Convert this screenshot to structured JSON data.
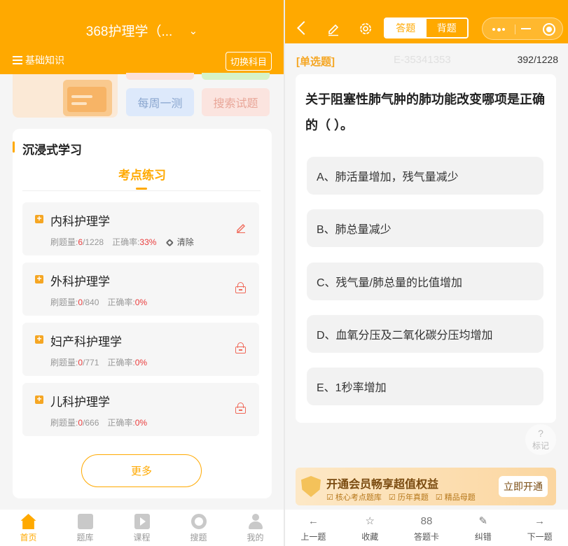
{
  "left": {
    "header": {
      "title": "368护理学（...",
      "subject_label": "基础知识",
      "switch_label": "切换科目"
    },
    "promo": {
      "weekly_test": "每周一测",
      "search_questions": "搜索试题"
    },
    "study": {
      "section_title": "沉浸式学习",
      "active_tab": "考点练习",
      "items": [
        {
          "name": "内科护理学",
          "done_label": "刷题量:",
          "done": "6",
          "total": "/1228",
          "accuracy_label": "正确率:",
          "accuracy": "33%",
          "clear_label": "清除",
          "action": "edit-icon"
        },
        {
          "name": "外科护理学",
          "done_label": "刷题量:",
          "done": "0",
          "total": "/840",
          "accuracy_label": "正确率:",
          "accuracy": "0%",
          "action": "lock-icon"
        },
        {
          "name": "妇产科护理学",
          "done_label": "刷题量:",
          "done": "0",
          "total": "/771",
          "accuracy_label": "正确率:",
          "accuracy": "0%",
          "action": "lock-icon"
        },
        {
          "name": "儿科护理学",
          "done_label": "刷题量:",
          "done": "0",
          "total": "/666",
          "accuracy_label": "正确率:",
          "accuracy": "0%",
          "action": "lock-icon"
        }
      ],
      "more_label": "更多"
    },
    "nav": [
      {
        "label": "首页",
        "icon": "home-icon",
        "active": true
      },
      {
        "label": "题库",
        "icon": "question-bank-icon"
      },
      {
        "label": "课程",
        "icon": "course-play-icon"
      },
      {
        "label": "搜题",
        "icon": "search-question-icon"
      },
      {
        "label": "我的",
        "icon": "profile-icon"
      }
    ]
  },
  "right": {
    "header": {
      "mode_answer": "答题",
      "mode_recite": "背题"
    },
    "question": {
      "type": "[单选题]",
      "code": "E-35341353",
      "progress": "392/1228",
      "stem": "关于阻塞性肺气肿的肺功能改变哪项是正确的（ ）。",
      "options": [
        "A、肺活量增加，残气量减少",
        "B、肺总量减少",
        "C、残气量/肺总量的比值增加",
        "D、血氧分压及二氧化碳分压均增加",
        "E、1秒率增加"
      ]
    },
    "mark": {
      "icon": "?",
      "label": "标记"
    },
    "vip": {
      "title": "开通会员畅享超值权益",
      "tags": [
        "核心考点题库",
        "历年真题",
        "精品母题"
      ],
      "button": "立即开通"
    },
    "toolbar": [
      {
        "label": "上一题",
        "icon": "←"
      },
      {
        "label": "收藏",
        "icon": "☆"
      },
      {
        "label": "答题卡",
        "icon": "88"
      },
      {
        "label": "纠错",
        "icon": "✎"
      },
      {
        "label": "下一题",
        "icon": "→"
      }
    ]
  },
  "colors": {
    "accent": "#ffa900",
    "danger": "#e93b3b"
  }
}
